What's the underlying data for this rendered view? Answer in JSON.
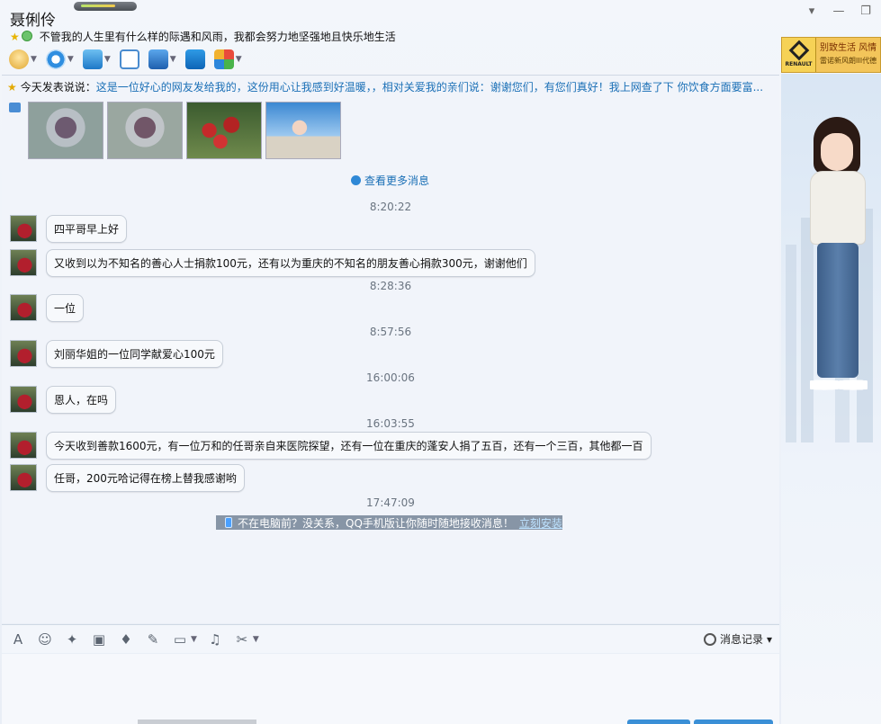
{
  "window": {
    "contact_name": "聂俐伶",
    "signature": "不管我的人生里有什么样的际遇和风雨，我都会努力地坚强地且快乐地生活",
    "controls": [
      "▾",
      "—",
      "❐"
    ]
  },
  "ad": {
    "brand": "RENAULT",
    "line1": "别致生活 风情",
    "line2": "雷诺新风朗III代德"
  },
  "feed": {
    "label": "今天发表说说：",
    "text": "这是一位好心的网友发给我的，这份用心让我感到好温暖，，相对关爱我的亲们说：谢谢您们，有您们真好！我上网查了下 你饮食方面要富..."
  },
  "more_messages": "查看更多消息",
  "messages": [
    {
      "time": "8:20:22",
      "text": "四平哥早上好"
    },
    {
      "time": "",
      "text": "又收到以为不知名的善心人士捐款100元，还有以为重庆的不知名的朋友善心捐款300元，谢谢他们"
    },
    {
      "time": "8:28:36",
      "text": "一位"
    },
    {
      "time": "8:57:56",
      "text": "刘丽华姐的一位同学献爱心100元"
    },
    {
      "time": "16:00:06",
      "text": "恩人，在吗"
    },
    {
      "time": "16:03:55",
      "text": "今天收到善款1600元，有一位万和的任哥亲自来医院探望，还有一位在重庆的蓬安人捐了五百，还有一个三百，其他都一百"
    },
    {
      "time": "",
      "text": "任哥，200元哈记得在榜上替我感谢哟"
    }
  ],
  "last_time": "17:47:09",
  "mobile_tip": {
    "text": "不在电脑前？没关系，QQ手机版让你随时随地接收消息！",
    "link": "立刻安装"
  },
  "input_toolbar": {
    "history_label": "消息记录",
    "icons": [
      "font-icon",
      "emoji-icon",
      "shake-icon",
      "screenshot-icon",
      "voice-icon",
      "edit-icon",
      "image-icon",
      "music-icon",
      "scissors-icon"
    ]
  }
}
